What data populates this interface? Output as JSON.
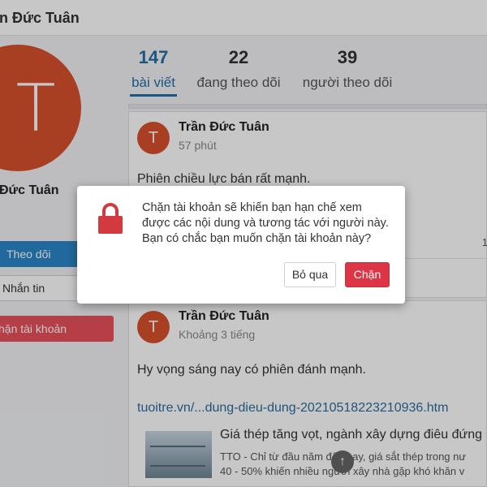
{
  "header": {
    "title": "ần Đức Tuân"
  },
  "profile": {
    "avatar_letter": "T",
    "name": "Đức Tuân",
    "follow_label": "Theo dõi",
    "message_label": "Nhắn tin",
    "block_label": "hặn tài khoản"
  },
  "stats": [
    {
      "value": "147",
      "label": "bài viết"
    },
    {
      "value": "22",
      "label": "đang theo dõi"
    },
    {
      "value": "39",
      "label": "người theo dõi"
    }
  ],
  "posts": [
    {
      "avatar_letter": "T",
      "author": "Trần Đức Tuân",
      "time": "57 phút",
      "content": "Phiên chiều lực bán rất mạnh.",
      "count": "1"
    },
    {
      "avatar_letter": "T",
      "author": "Trần Đức Tuân",
      "time": "Khoảng 3 tiếng",
      "content": "Hy vọng sáng nay có phiên đánh mạnh.",
      "link": "tuoitre.vn/...dung-dieu-dung-20210518223210936.htm",
      "preview": {
        "title": "Giá thép tăng vọt, ngành xây dựng điêu đứng",
        "desc_line1": "TTO - Chỉ từ đầu năm đến nay, giá sắt thép trong nư",
        "desc_line2": "40 - 50% khiến nhiều người xây nhà gặp khó khăn v"
      }
    }
  ],
  "dialog": {
    "message": "Chặn tài khoản sẽ khiến bạn hạn chế xem được các nội dung và tương tác với người này. Bạn có chắc bạn muốn chặn tài khoản này?",
    "cancel_label": "Bỏ qua",
    "confirm_label": "Chặn",
    "icon": "lock-icon"
  },
  "colors": {
    "accent": "#1f6fa8",
    "avatar": "#d9512c",
    "danger": "#dc3545",
    "follow": "#2b87c8"
  }
}
